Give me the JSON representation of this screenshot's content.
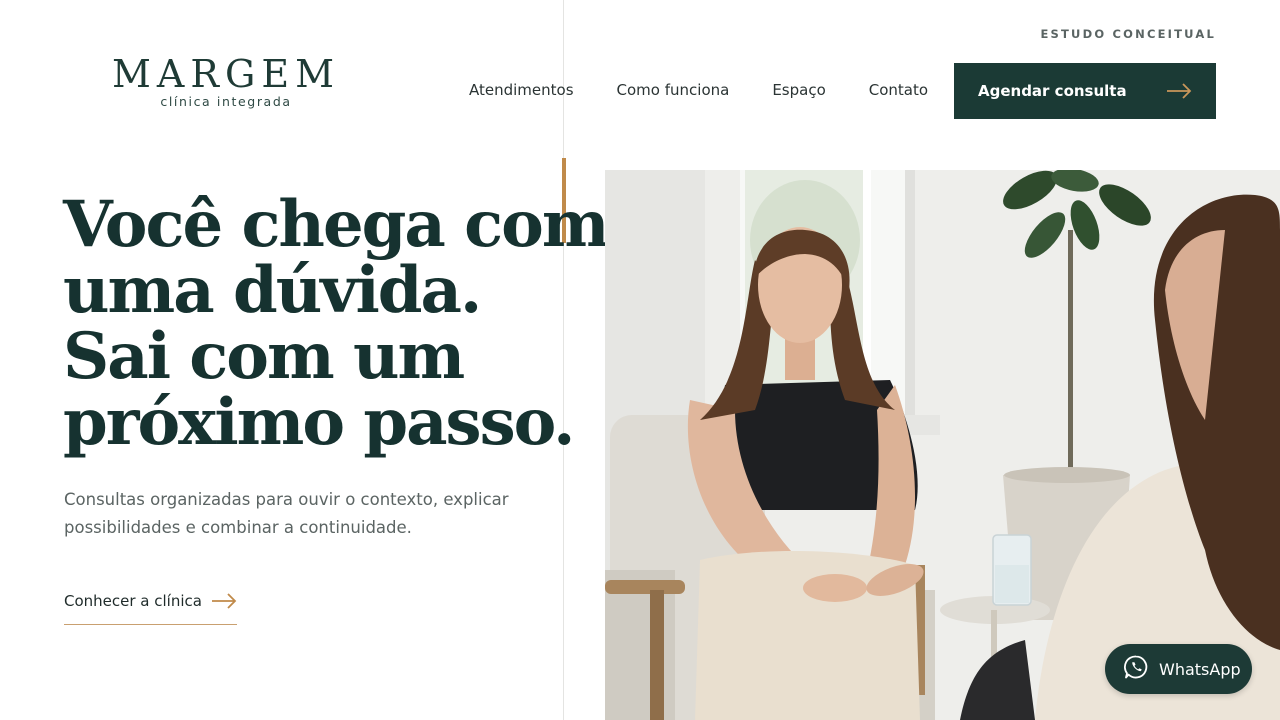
{
  "brand": {
    "name": "MARGEM",
    "tagline": "clínica integrada"
  },
  "header": {
    "concept_tag": "ESTUDO CONCEITUAL",
    "nav": [
      {
        "label": "Atendimentos"
      },
      {
        "label": "Como funciona"
      },
      {
        "label": "Espaço"
      },
      {
        "label": "Contato"
      }
    ],
    "cta_label": "Agendar consulta"
  },
  "hero": {
    "headline_lines": [
      "Você chega com",
      "uma dúvida.",
      "Sai com um",
      "próximo passo."
    ],
    "lede": "Consultas organizadas para ouvir o contexto, explicar possibilidades e combinar a continuidade.",
    "link_label": "Conhecer a clínica"
  },
  "whatsapp": {
    "label": "WhatsApp"
  },
  "colors": {
    "primary": "#1b3a35",
    "accent": "#c08a4a",
    "text": "#163230"
  },
  "icons": {
    "cta": "arrow-right-icon",
    "link": "arrow-right-icon",
    "whatsapp": "whatsapp-icon"
  }
}
